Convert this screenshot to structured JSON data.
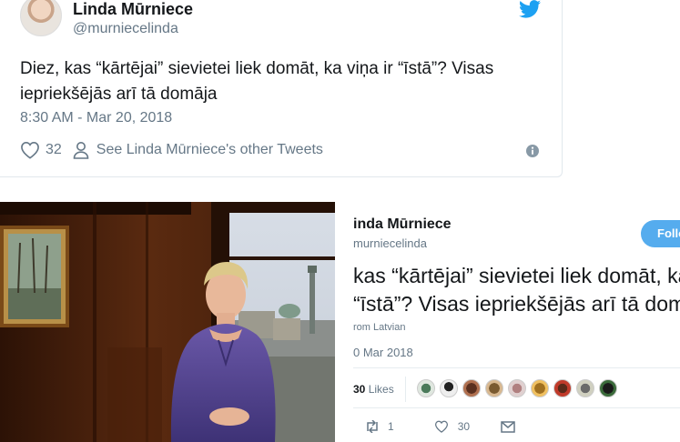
{
  "tweet": {
    "name": "Linda Mūrniece",
    "handle": "@murniecelinda",
    "text": "Diez, kas “kārtējai” sievietei liek domāt, ka viņa ir “īstā”?  Visas iepriekšējās arī tā domāja",
    "timestamp": "8:30 AM - Mar 20, 2018",
    "likes": "32",
    "see_other": "See Linda Mūrniece's other Tweets"
  },
  "screenshot": {
    "name": "inda Mūrniece",
    "handle": "murniecelinda",
    "follow_label": "Follo",
    "text_line1": "kas “kārtējai” sievietei liek domāt, ka",
    "text_line2": "“īstā”?  Visas iepriekšējās arī tā doma",
    "from": "rom Latvian",
    "date": "0 Mar 2018",
    "likes_count": "30",
    "likes_label": "Likes",
    "retweets": "1",
    "like_count": "30"
  },
  "colors": {
    "twitter_blue": "#1da1f2",
    "follow_blue": "#55acee",
    "muted": "#657786",
    "dress_purple": "#5b4a96"
  },
  "icons": [
    "twitter-bird-icon",
    "heart-icon",
    "person-icon",
    "info-icon",
    "retweet-icon",
    "reply-icon",
    "dm-icon"
  ]
}
